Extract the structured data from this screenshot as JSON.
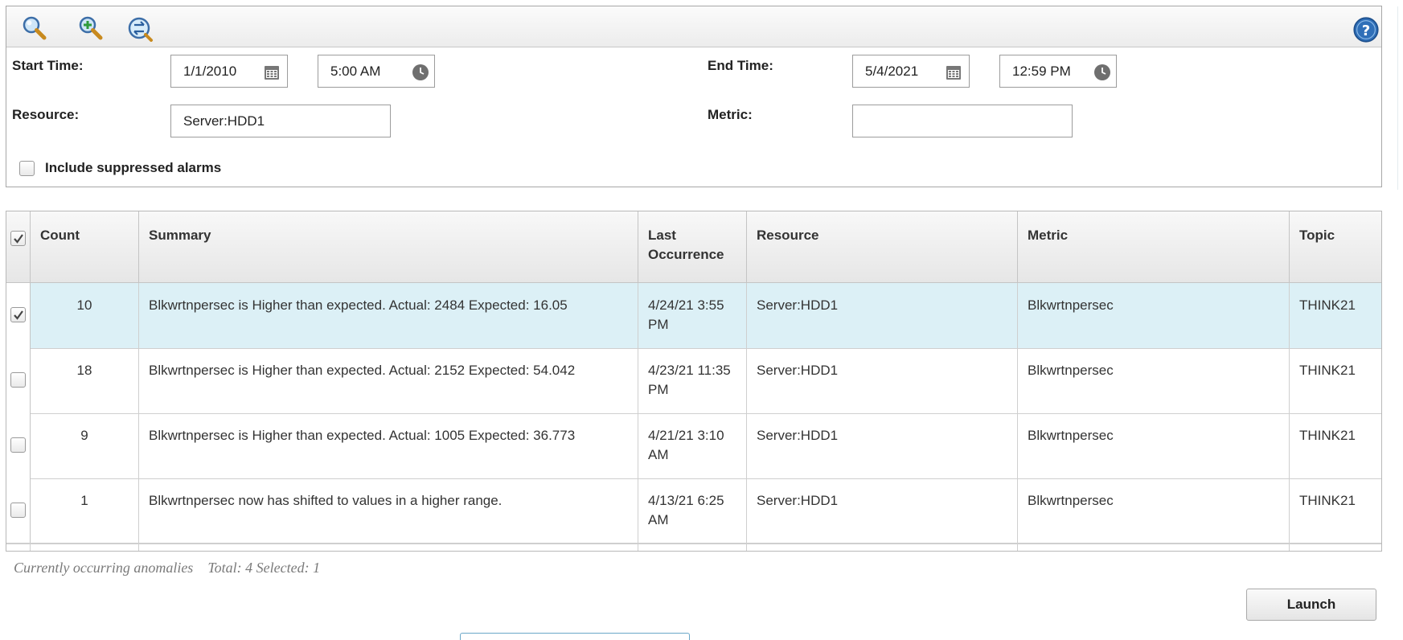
{
  "toolbar": {
    "icons": [
      "search-icon",
      "search-add-icon",
      "search-refresh-icon",
      "help-icon"
    ]
  },
  "filters": {
    "start_time_label": "Start Time:",
    "start_date": "1/1/2010",
    "start_time": "5:00 AM",
    "end_time_label": "End Time:",
    "end_date": "5/4/2021",
    "end_time": "12:59 PM",
    "resource_label": "Resource:",
    "resource_value": "Server:HDD1",
    "metric_label": "Metric:",
    "metric_value": "",
    "suppressed_label": "Include suppressed alarms",
    "suppressed_checked": false
  },
  "table": {
    "columns": [
      "Count",
      "Summary",
      "Last Occurrence",
      "Resource",
      "Metric",
      "Topic"
    ],
    "header_checked": true,
    "rows": [
      {
        "checked": true,
        "count": "10",
        "summary": "Blkwrtnpersec is Higher than expected. Actual: 2484 Expected: 16.05",
        "last": "4/24/21 3:55 PM",
        "resource": "Server:HDD1",
        "metric": "Blkwrtnpersec",
        "topic": "THINK21"
      },
      {
        "checked": false,
        "count": "18",
        "summary": "Blkwrtnpersec is Higher than expected. Actual: 2152 Expected: 54.042",
        "last": "4/23/21 11:35 PM",
        "resource": "Server:HDD1",
        "metric": "Blkwrtnpersec",
        "topic": "THINK21"
      },
      {
        "checked": false,
        "count": "9",
        "summary": "Blkwrtnpersec is Higher than expected. Actual: 1005 Expected: 36.773",
        "last": "4/21/21 3:10 AM",
        "resource": "Server:HDD1",
        "metric": "Blkwrtnpersec",
        "topic": "THINK21"
      },
      {
        "checked": false,
        "count": "1",
        "summary": "Blkwrtnpersec now has shifted to values in a higher range.",
        "last": "4/13/21 6:25 AM",
        "resource": "Server:HDD1",
        "metric": "Blkwrtnpersec",
        "topic": "THINK21"
      }
    ]
  },
  "status": {
    "caption": "Currently occurring anomalies",
    "total_label": "Total: 4",
    "selected_label": "Selected: 1"
  },
  "actions": {
    "launch_label": "Launch"
  },
  "colors": {
    "selected_row": "#dcf0f6",
    "help_blue": "#2f6fb8"
  }
}
